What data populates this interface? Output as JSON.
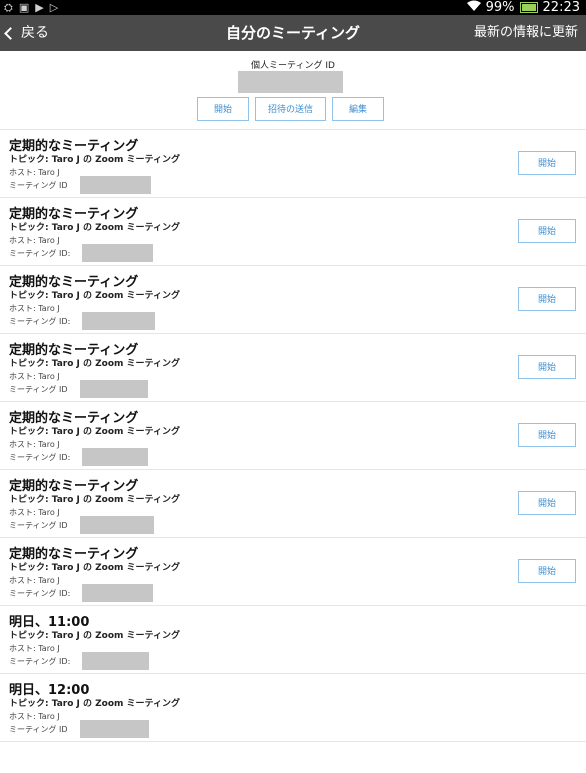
{
  "status_bar": {
    "left_icons": [
      "usb-icon",
      "photo-icon",
      "play-icon",
      "play-icon"
    ],
    "battery": "99%",
    "battery_level": 0.99,
    "time": "22:23"
  },
  "nav": {
    "back_label": "戻る",
    "title": "自分のミーティング",
    "refresh_label": "最新の情報に更新"
  },
  "pmi": {
    "label": "個人ミーティング ID",
    "buttons": {
      "start": "開始",
      "invite": "招待の送信",
      "edit": "編集"
    }
  },
  "meetings": [
    {
      "title": "定期的なミーティング",
      "topic": "トピック: Taro J の Zoom ミーティング",
      "host": "ホスト: Taro J",
      "id_label": "ミーティング ID",
      "start": "開始"
    },
    {
      "title": "定期的なミーティング",
      "topic": "トピック: Taro J の Zoom ミーティング",
      "host": "ホスト: Taro J",
      "id_label": "ミーティング ID:",
      "start": "開始"
    },
    {
      "title": "定期的なミーティング",
      "topic": "トピック: Taro J の Zoom ミーティング",
      "host": "ホスト: Taro J",
      "id_label": "ミーティング ID:",
      "start": "開始"
    },
    {
      "title": "定期的なミーティング",
      "topic": "トピック: Taro J の Zoom ミーティング",
      "host": "ホスト: Taro J",
      "id_label": "ミーティング ID",
      "start": "開始"
    },
    {
      "title": "定期的なミーティング",
      "topic": "トピック: Taro J の Zoom ミーティング",
      "host": "ホスト: Taro J",
      "id_label": "ミーティング ID:",
      "start": "開始"
    },
    {
      "title": "定期的なミーティング",
      "topic": "トピック: Taro J の Zoom ミーティング",
      "host": "ホスト: Taro J",
      "id_label": "ミーティング ID",
      "start": "開始"
    },
    {
      "title": "定期的なミーティング",
      "topic": "トピック: Taro J の Zoom ミーティング",
      "host": "ホスト: Taro J",
      "id_label": "ミーティング ID:",
      "start": "開始"
    },
    {
      "title": "明日、11:00",
      "topic": "トピック: Taro J の Zoom ミーティング",
      "host": "ホスト: Taro J",
      "id_label": "ミーティング ID:"
    },
    {
      "title": "明日、12:00",
      "topic": "トピック: Taro J の Zoom ミーティング",
      "host": "ホスト: Taro J",
      "id_label": "ミーティング ID"
    }
  ]
}
